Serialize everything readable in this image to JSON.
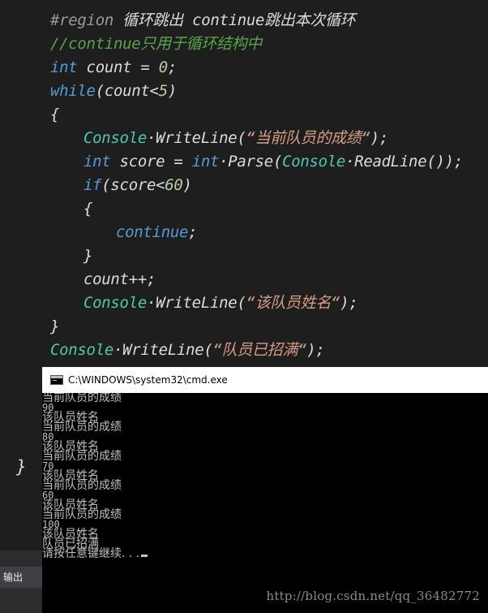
{
  "code": {
    "line1": {
      "region_kw": "#region",
      "region_text": " 循环跳出 continue跳出本次循环"
    },
    "line2": {
      "comment": "//continue只用于循环结构中"
    },
    "line3": {
      "kw": "int",
      "rest_a": " count = ",
      "num": "0",
      "rest_b": ";"
    },
    "line4": {
      "kw": "while",
      "rest_a": "(count<",
      "num": "5",
      "rest_b": ")"
    },
    "line5": {
      "text": "{"
    },
    "line6": {
      "type": "Console",
      "rest_a": "·WriteLine(",
      "str": "“当前队员的成绩“",
      "rest_b": ");"
    },
    "line7": {
      "kw1": "int",
      "rest_a": " score = ",
      "kw2": "int",
      "rest_b": "·Parse(",
      "type": "Console",
      "rest_c": "·ReadLine());"
    },
    "line8": {
      "kw": "if",
      "rest_a": "(score<",
      "num": "60",
      "rest_b": ")"
    },
    "line9": {
      "text": "{"
    },
    "line10": {
      "kw": "continue",
      "rest": ";"
    },
    "line11": {
      "text": "}"
    },
    "line12": {
      "text": "count++;"
    },
    "line13": {
      "type": "Console",
      "rest_a": "·WriteLine(",
      "str": "“该队员姓名“",
      "rest_b": ");"
    },
    "line14": {
      "text": "}"
    },
    "line15": {
      "type": "Console",
      "rest_a": "·WriteLine(",
      "str": "“队员已招满“",
      "rest_b": ");"
    },
    "outer_brace": "}"
  },
  "output_panel": {
    "tab_label": "输出"
  },
  "console": {
    "title": "C:\\WINDOWS\\system32\\cmd.exe",
    "lines": [
      "当前队员的成绩",
      "90",
      "该队员姓名",
      "当前队员的成绩",
      "80",
      "该队员姓名",
      "当前队员的成绩",
      "70",
      "该队员姓名",
      "当前队员的成绩",
      "60",
      "该队员姓名",
      "当前队员的成绩",
      "100",
      "该队员姓名",
      "队员已招满",
      "请按任意键继续. . ."
    ]
  },
  "watermark": "http://blog.csdn.net/qq_36482772",
  "colors": {
    "editor_bg": "#1e1e1e",
    "keyword": "#569cd6",
    "type": "#4ec9b0",
    "string": "#d69d85",
    "number": "#b5cea8",
    "comment": "#57a64a",
    "console_bg": "#000000",
    "console_text": "#c0c0c0"
  }
}
